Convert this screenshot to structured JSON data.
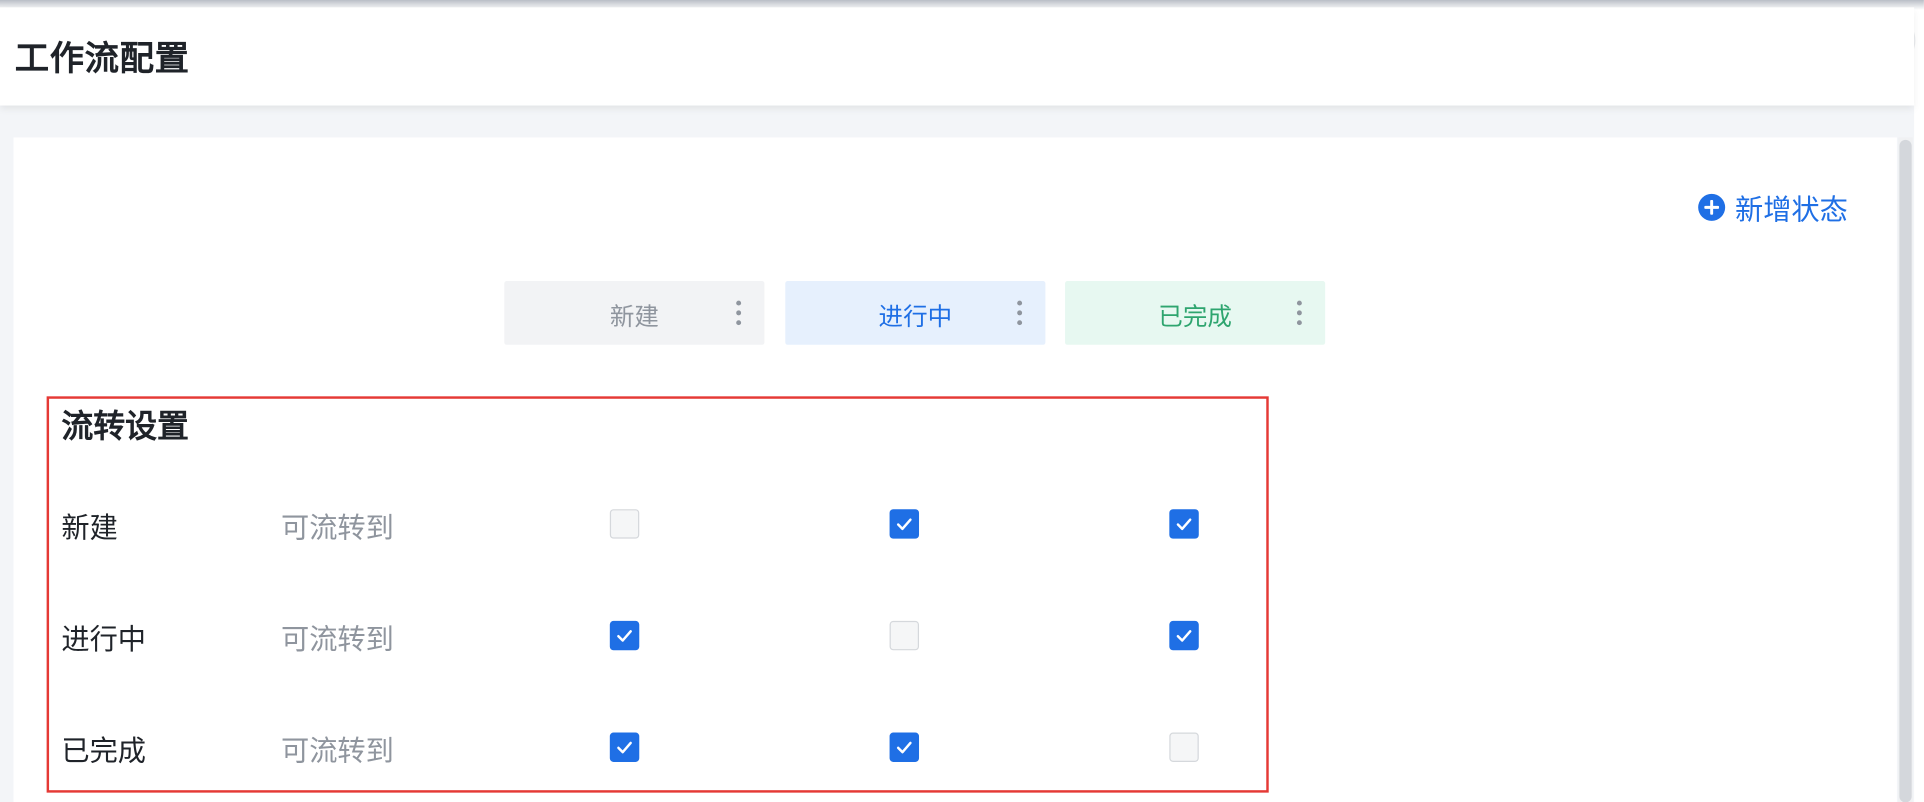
{
  "dialog": {
    "title": "工作流配置",
    "close_icon": "close-icon"
  },
  "toolbar": {
    "add_status_label": "新增状态",
    "add_icon": "plus-circle-icon"
  },
  "statuses": [
    {
      "label": "新建",
      "color": "#8f959e",
      "bg": "#f2f3f5"
    },
    {
      "label": "进行中",
      "color": "#1f6fe5",
      "bg": "#e6f0fd"
    },
    {
      "label": "已完成",
      "color": "#2ea56f",
      "bg": "#e7f8f1"
    }
  ],
  "flow": {
    "title": "流转设置",
    "rows": [
      {
        "from": "新建",
        "hint": "可流转到",
        "to": [
          false,
          true,
          true
        ]
      },
      {
        "from": "进行中",
        "hint": "可流转到",
        "to": [
          true,
          false,
          true
        ]
      },
      {
        "from": "已完成",
        "hint": "可流转到",
        "to": [
          true,
          true,
          false
        ]
      }
    ]
  },
  "colors": {
    "accent": "#1f6fe5",
    "highlight_border": "#e53935"
  }
}
